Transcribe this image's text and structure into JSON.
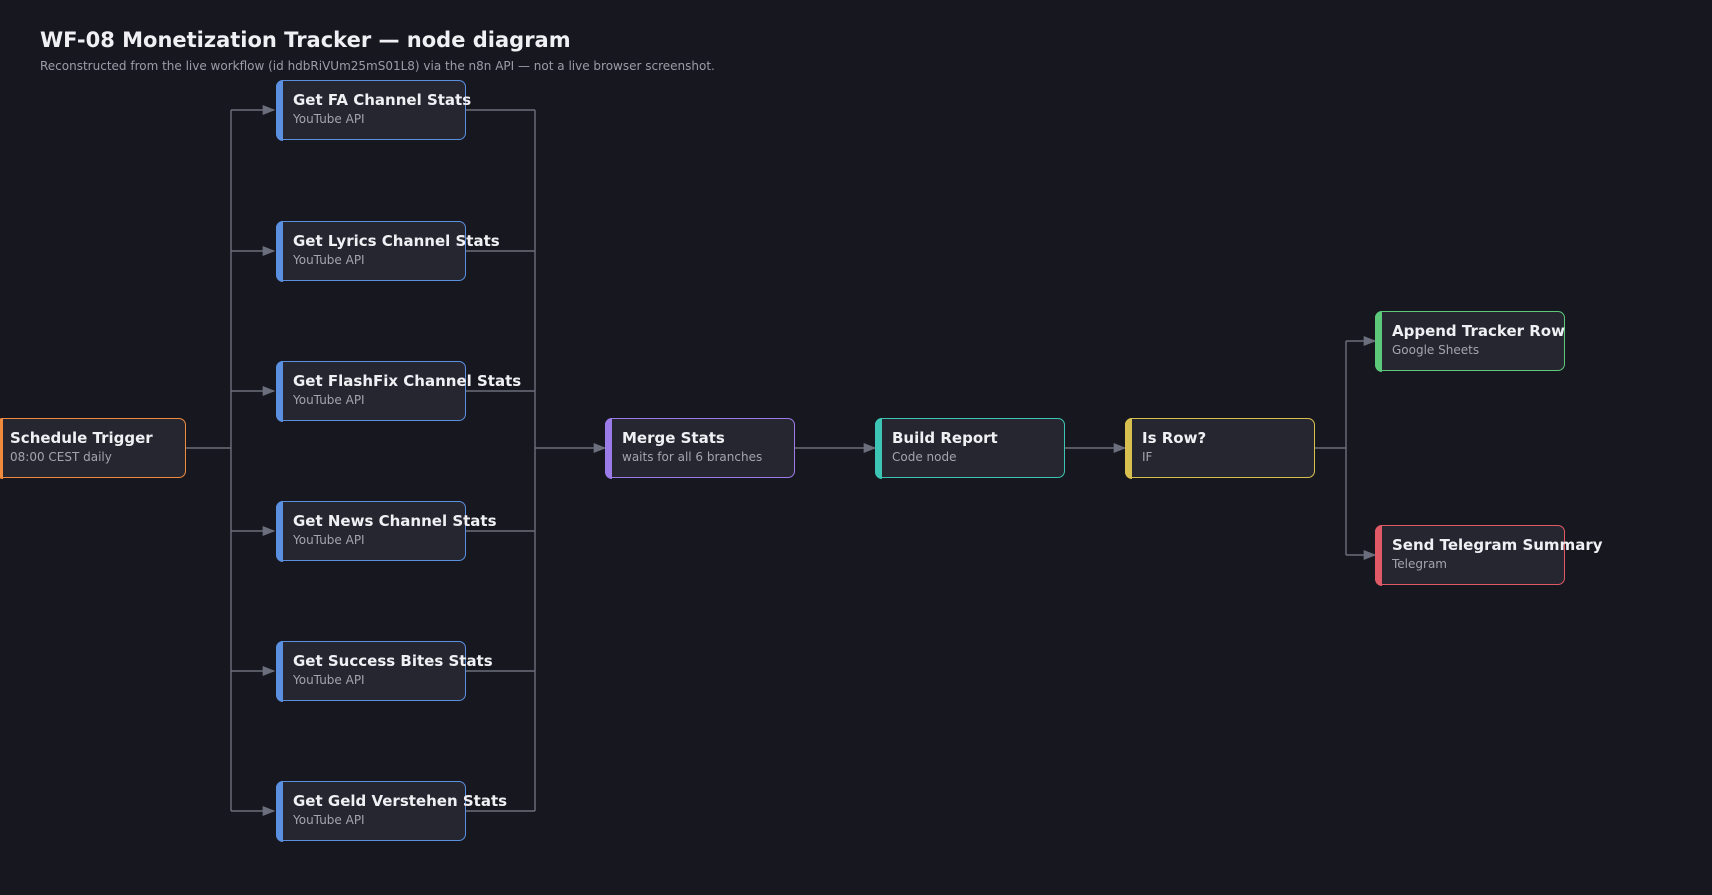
{
  "header": {
    "title": "WF-08 Monetization Tracker — node diagram",
    "subtitle": "Reconstructed from the live workflow (id hdbRiVUm25mS01L8) via the n8n API — not a live browser screenshot."
  },
  "colors": {
    "background": "#17181f",
    "node_fill": "#252630",
    "connector": "#6b6e7c",
    "trigger": "#f08a3c",
    "youtube": "#5b8fe0",
    "merge": "#9b7be8",
    "code": "#3cc4b4",
    "if": "#d8c050",
    "sheets": "#5cc87a",
    "telegram": "#e05a66"
  },
  "nodes": {
    "schedule_trigger": {
      "title": "Schedule Trigger",
      "subtitle": "08:00 CEST daily"
    },
    "get_fa": {
      "title": "Get FA Channel Stats",
      "subtitle": "YouTube API"
    },
    "get_lyrics": {
      "title": "Get Lyrics Channel Stats",
      "subtitle": "YouTube API"
    },
    "get_flashfix": {
      "title": "Get FlashFix Channel Stats",
      "subtitle": "YouTube API"
    },
    "get_news": {
      "title": "Get News Channel Stats",
      "subtitle": "YouTube API"
    },
    "get_success_bites": {
      "title": "Get Success Bites Stats",
      "subtitle": "YouTube API"
    },
    "get_geld_verstehen": {
      "title": "Get Geld Verstehen Stats",
      "subtitle": "YouTube API"
    },
    "merge_stats": {
      "title": "Merge Stats",
      "subtitle": "waits for all 6 branches"
    },
    "build_report": {
      "title": "Build Report",
      "subtitle": "Code node"
    },
    "is_row": {
      "title": "Is Row?",
      "subtitle": "IF"
    },
    "append_tracker_row": {
      "title": "Append Tracker Row",
      "subtitle": "Google Sheets"
    },
    "send_telegram_summary": {
      "title": "Send Telegram Summary",
      "subtitle": "Telegram"
    }
  }
}
